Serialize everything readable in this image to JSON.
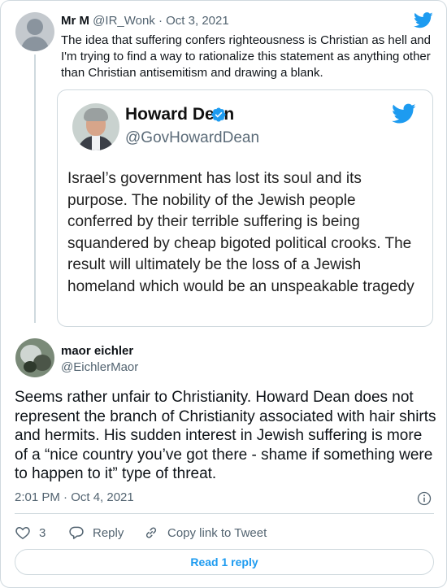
{
  "parent_tweet": {
    "name": "Mr M",
    "handle": "@IR_Wonk",
    "date": " · Oct 3, 2021",
    "text": "The idea that suffering confers righteousness is Christian as hell and I'm trying to find a way to rationalize this statement as anything other than Christian antisemitism and drawing a blank."
  },
  "embedded_image": {
    "name": "Howard Dean",
    "handle": "@GovHowardDean",
    "text": "Israel’s government has lost its soul and its purpose. The nobility of the Jewish people conferred by their terrible suffering is being squandered by cheap bigoted political crooks. The result will ultimately be the loss of a Jewish homeland which would be an unspeakable tragedy"
  },
  "reply_tweet": {
    "name": "maor eichler",
    "handle": "@EichlerMaor",
    "text": "Seems rather unfair to Christianity. Howard Dean does not represent the branch of Christianity associated with hair shirts and hermits. His sudden interest in Jewish suffering is more of a “nice country you’ve got there - shame if something were to happen to it” type of threat.",
    "timestamp": "2:01 PM · Oct 4, 2021"
  },
  "actions": {
    "like_count": "3",
    "reply_label": "Reply",
    "copy_link_label": "Copy link to Tweet"
  },
  "read_replies_label": "Read 1 reply",
  "colors": {
    "twitter_blue": "#1d9bf0",
    "verified_blue": "#1d9bf0",
    "secondary_text": "#536471",
    "border": "#cfd9de"
  },
  "icons": {
    "brand": "twitter-bird-icon",
    "verified": "verified-badge-icon",
    "info": "info-icon",
    "like": "heart-icon",
    "reply": "reply-bubble-icon",
    "copy_link": "link-icon"
  }
}
